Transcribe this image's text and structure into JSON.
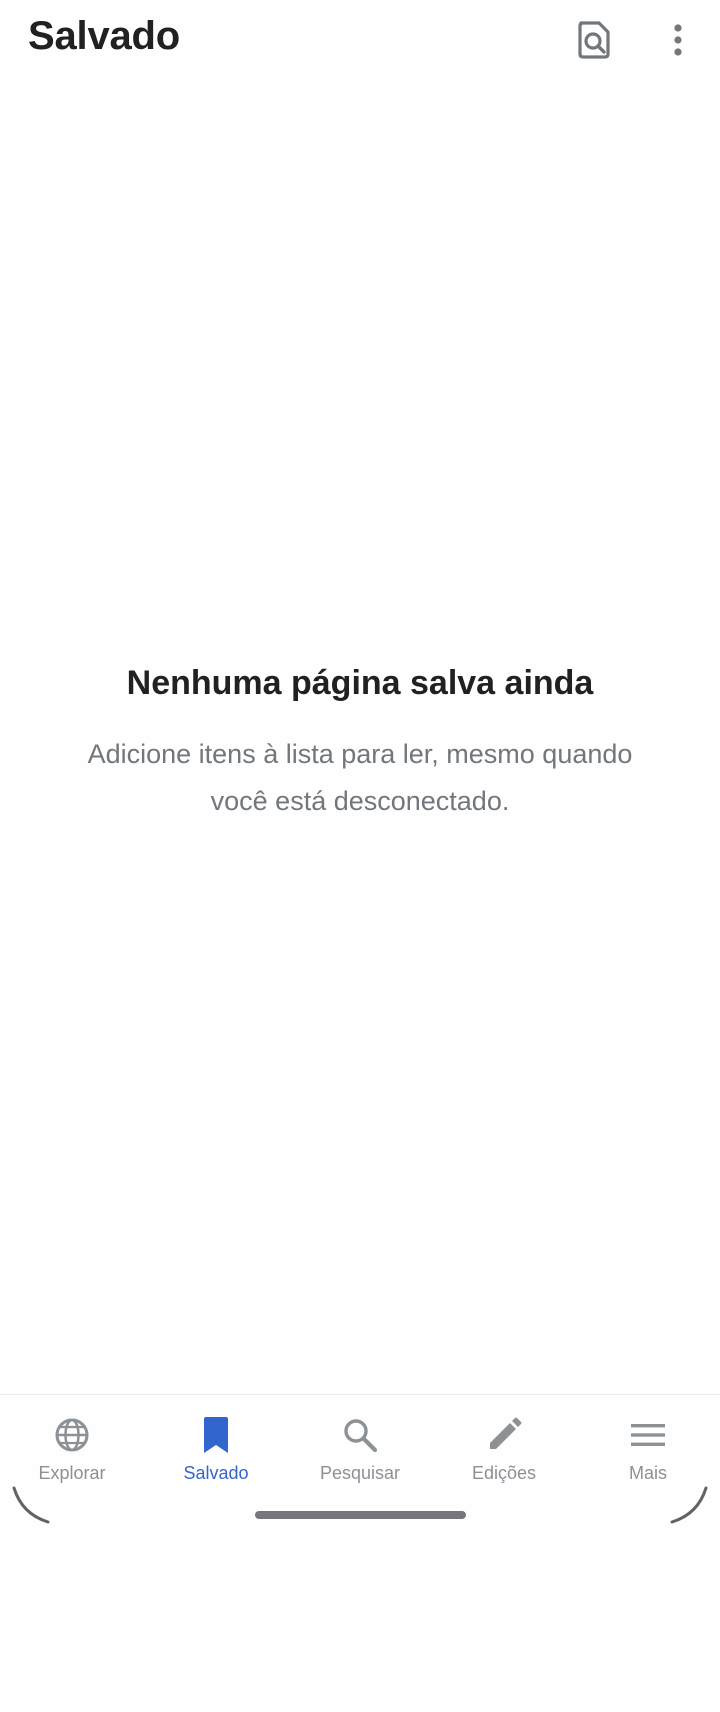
{
  "header": {
    "title": "Salvado"
  },
  "toolbar": {
    "reading_list_icon": "search-in-document-icon",
    "overflow_icon": "more-vert-icon"
  },
  "empty_state": {
    "title": "Nenhuma página salva ainda",
    "message": "Adicione itens à lista para ler, mesmo quando você está desconectado."
  },
  "bottom_nav": {
    "active": "saved",
    "accent_color": "#3366cc",
    "inactive_color": "#8c9196",
    "items": [
      {
        "id": "explore",
        "label": "Explorar",
        "icon": "globe-icon"
      },
      {
        "id": "saved",
        "label": "Salvado",
        "icon": "bookmark-icon"
      },
      {
        "id": "search",
        "label": "Pesquisar",
        "icon": "search-icon"
      },
      {
        "id": "edits",
        "label": "Edições",
        "icon": "pencil-icon"
      },
      {
        "id": "more",
        "label": "Mais",
        "icon": "menu-icon"
      }
    ]
  }
}
